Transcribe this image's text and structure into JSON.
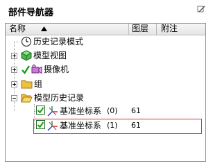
{
  "panel": {
    "title": "部件导航器",
    "columns": {
      "name": "名称",
      "layer": "图层",
      "note": "附注"
    }
  },
  "tree": {
    "history_mode": "历史记录模式",
    "model_views": "模型视图",
    "cameras": "摄像机",
    "group": "组",
    "model_history": "模型历史记录",
    "datum1": {
      "name": "基准坐标系",
      "index": "(0)",
      "layer": "61"
    },
    "datum2": {
      "name": "基准坐标系",
      "index": "(1)",
      "layer": "61"
    }
  },
  "colors": {
    "highlight": "#cc3333",
    "check": "#1a9a1a",
    "folder": "#f0c040"
  }
}
